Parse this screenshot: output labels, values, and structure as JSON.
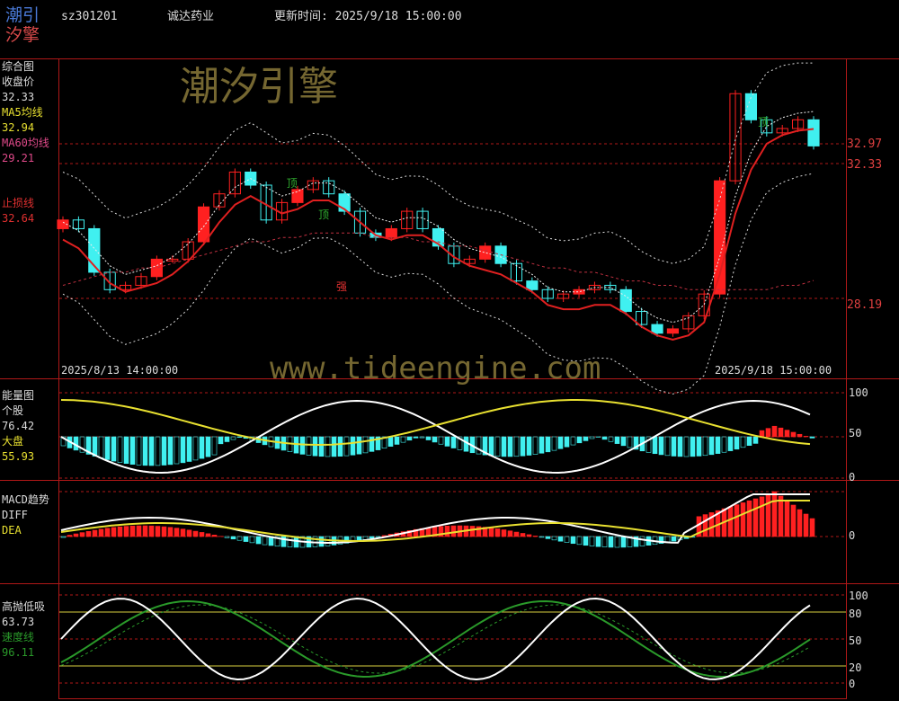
{
  "header": {
    "logo_line1": "潮引",
    "logo_line2": "汐擎",
    "symbol": "sz301201",
    "name": "诚达药业",
    "update_label": "更新时间:",
    "update_time": "2025/9/18 15:00:00"
  },
  "watermarks": {
    "brand": "潮汐引擎",
    "url": "www.tideengine.com"
  },
  "colors": {
    "frame": "#b01818",
    "ma5": "#e8e030",
    "ma60": "#e04a8a",
    "price_line": "#e02020",
    "up_candle": "#ff2020",
    "down_candle": "#40f0f0",
    "white_line": "#ffffff",
    "yellow_line": "#e8e030",
    "green_line": "#2a9a2a",
    "marker_green": "#30b030",
    "axis_label": "#e04040"
  },
  "main_panel": {
    "title": "综合图",
    "close_label": "收盘价",
    "close_value": "32.33",
    "ma5_label": "MA5均线",
    "ma5_value": "32.94",
    "ma60_label": "MA60均线",
    "ma60_value": "29.21",
    "stop_label": "止损线",
    "stop_value": "32.64",
    "right_axis": [
      "32.97",
      "32.33",
      "28.19"
    ],
    "date_start": "2025/8/13 14:00:00",
    "date_end": "2025/9/18 15:00:00",
    "markers": [
      {
        "text": "顶"
      },
      {
        "text": "顶"
      },
      {
        "text": "强"
      },
      {
        "text": "顶"
      }
    ]
  },
  "energy_panel": {
    "title": "能量图",
    "stock_label": "个股",
    "stock_value": "76.42",
    "market_label": "大盘",
    "market_value": "55.93",
    "axis": [
      "100",
      "50",
      "0"
    ]
  },
  "macd_panel": {
    "title": "MACD趋势",
    "diff_label": "DIFF",
    "dea_label": "DEA",
    "axis": [
      "0"
    ]
  },
  "kdj_panel": {
    "title": "高抛低吸",
    "value1": "63.73",
    "speed_label": "速度线",
    "speed_value": "96.11",
    "axis": [
      "100",
      "80",
      "50",
      "20",
      "0"
    ]
  },
  "chart_data": {
    "type": "line",
    "title": "sz301201 诚达药业",
    "series": [
      {
        "name": "收盘价",
        "values": [
          30.6,
          30.4,
          29.4,
          29.0,
          29.1,
          29.3,
          29.7,
          29.7,
          30.1,
          30.9,
          31.2,
          31.7,
          31.4,
          30.6,
          31.0,
          31.3,
          31.5,
          31.2,
          30.8,
          30.3,
          30.2,
          30.4,
          30.8,
          30.4,
          30.0,
          29.6,
          29.7,
          30.0,
          29.6,
          29.2,
          29.0,
          28.8,
          28.9,
          29.0,
          29.1,
          29.0,
          28.5,
          28.2,
          28.0,
          28.1,
          28.4,
          28.9,
          31.5,
          33.5,
          32.9,
          32.6,
          32.7,
          32.9,
          32.3
        ]
      },
      {
        "name": "MA5均线",
        "values": [
          30.4,
          30.2,
          29.8,
          29.4,
          29.2,
          29.3,
          29.4,
          29.6,
          29.9,
          30.3,
          30.8,
          31.2,
          31.4,
          31.2,
          31.0,
          31.1,
          31.3,
          31.3,
          31.1,
          30.8,
          30.5,
          30.4,
          30.5,
          30.5,
          30.3,
          30.0,
          29.8,
          29.7,
          29.6,
          29.4,
          29.2,
          28.9,
          28.8,
          28.8,
          28.9,
          28.9,
          28.7,
          28.4,
          28.2,
          28.1,
          28.2,
          28.5,
          29.6,
          31.0,
          32.0,
          32.6,
          32.8,
          32.9,
          32.94
        ]
      },
      {
        "name": "MA60均线",
        "values": [
          29.1,
          29.2,
          29.3,
          29.4,
          29.4,
          29.5,
          29.5,
          29.6,
          29.7,
          29.8,
          29.9,
          30.0,
          30.1,
          30.1,
          30.2,
          30.2,
          30.3,
          30.3,
          30.3,
          30.3,
          30.2,
          30.2,
          30.2,
          30.1,
          30.1,
          30.0,
          30.0,
          29.9,
          29.8,
          29.7,
          29.6,
          29.5,
          29.5,
          29.4,
          29.4,
          29.3,
          29.2,
          29.2,
          29.1,
          29.1,
          29.0,
          29.0,
          29.0,
          29.0,
          29.0,
          29.0,
          29.1,
          29.1,
          29.21
        ]
      }
    ],
    "ylim": [
      27.5,
      34.0
    ]
  }
}
